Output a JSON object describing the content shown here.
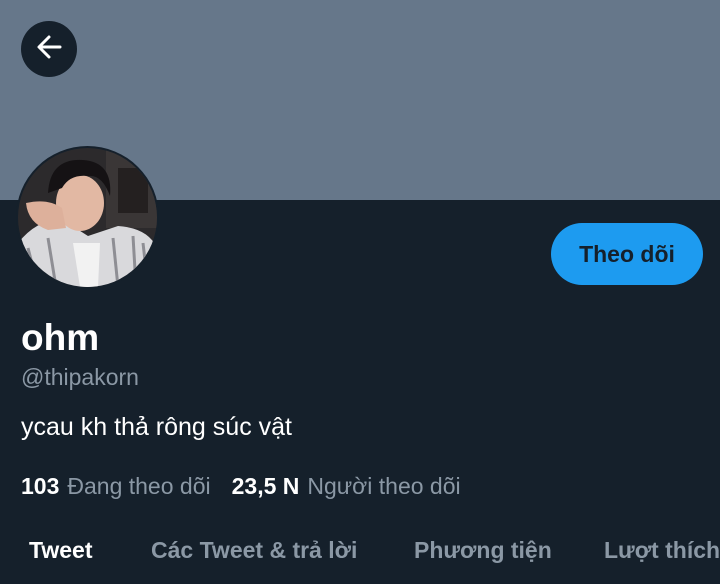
{
  "header": {
    "back_icon": "arrow-left-icon",
    "banner_color": "#66778a"
  },
  "profile": {
    "display_name": "ohm",
    "handle": "@thipakorn",
    "bio": "ycau kh thả rông súc vật",
    "follow_label": "Theo dõi",
    "following_count": "103",
    "following_label": "Đang theo dõi",
    "followers_count": "23,5 N",
    "followers_label": "Người theo dõi"
  },
  "tabs": [
    {
      "label": "Tweet",
      "active": true
    },
    {
      "label": "Các Tweet & trả lời",
      "active": false
    },
    {
      "label": "Phương tiện",
      "active": false
    },
    {
      "label": "Lượt thích",
      "active": false
    }
  ],
  "colors": {
    "background": "#15202b",
    "accent": "#1d9bf0",
    "secondary_text": "#8b98a5"
  }
}
